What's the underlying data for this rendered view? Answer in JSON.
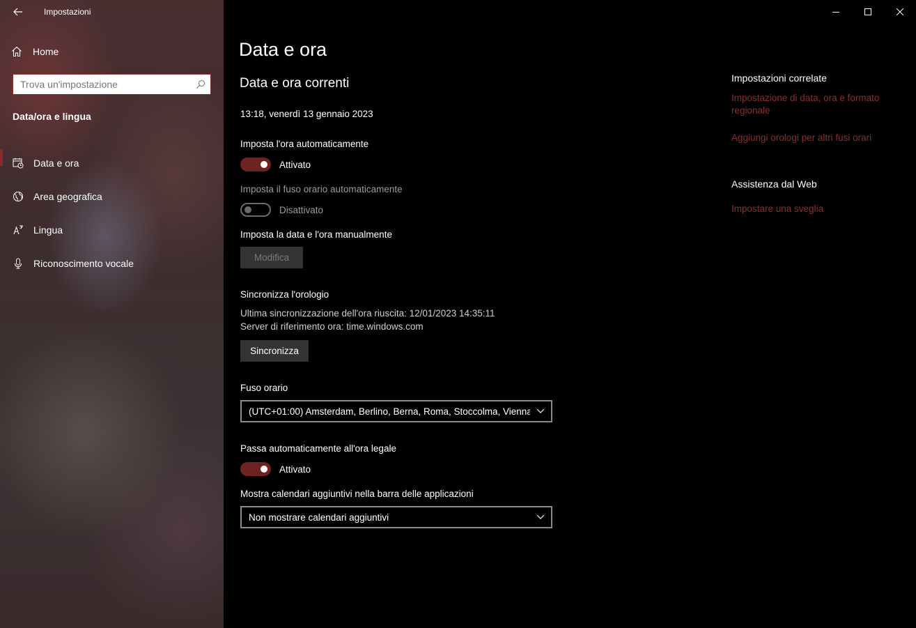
{
  "window": {
    "app_title": "Impostazioni",
    "back_icon": "back-arrow-icon",
    "controls": [
      "minimize-icon",
      "maximize-icon",
      "close-icon"
    ]
  },
  "sidebar": {
    "home_label": "Home",
    "search_placeholder": "Trova un'impostazione",
    "section_title": "Data/ora e lingua",
    "items": [
      {
        "label": "Data e ora",
        "icon": "date-time-icon",
        "active": true
      },
      {
        "label": "Area geografica",
        "icon": "globe-region-icon",
        "active": false
      },
      {
        "label": "Lingua",
        "icon": "language-icon",
        "active": false
      },
      {
        "label": "Riconoscimento vocale",
        "icon": "microphone-icon",
        "active": false
      }
    ]
  },
  "main": {
    "title": "Data e ora",
    "subtitle": "Data e ora correnti",
    "current_datetime": "13:18, venerdì 13 gennaio 2023",
    "auto_time": {
      "label": "Imposta l'ora automaticamente",
      "state": "Attivato",
      "on": true
    },
    "auto_timezone": {
      "label": "Imposta il fuso orario automaticamente",
      "state": "Disattivato",
      "on": false
    },
    "manual": {
      "label": "Imposta la data e l'ora manualmente",
      "button": "Modifica"
    },
    "sync": {
      "label": "Sincronizza l'orologio",
      "last_sync": "Ultima sincronizzazione dell'ora riuscita: 12/01/2023 14:35:11",
      "server": "Server di riferimento ora: time.windows.com",
      "button": "Sincronizza"
    },
    "timezone": {
      "label": "Fuso orario",
      "value": "(UTC+01:00) Amsterdam, Berlino, Berna, Roma, Stoccolma, Vienna"
    },
    "dst": {
      "label": "Passa automaticamente all'ora legale",
      "state": "Attivato",
      "on": true
    },
    "calendars": {
      "label": "Mostra calendari aggiuntivi nella barra delle applicazioni",
      "value": "Non mostrare calendari aggiuntivi"
    }
  },
  "related": {
    "title": "Impostazioni correlate",
    "links": [
      "Impostazione di data, ora e formato regionale",
      "Aggiungi orologi per altri fusi orari"
    ],
    "web_title": "Assistenza dal Web",
    "web_links": [
      "Impostare una sveglia"
    ]
  },
  "colors": {
    "accent": "#6e2323",
    "link": "#8b2e2e"
  }
}
